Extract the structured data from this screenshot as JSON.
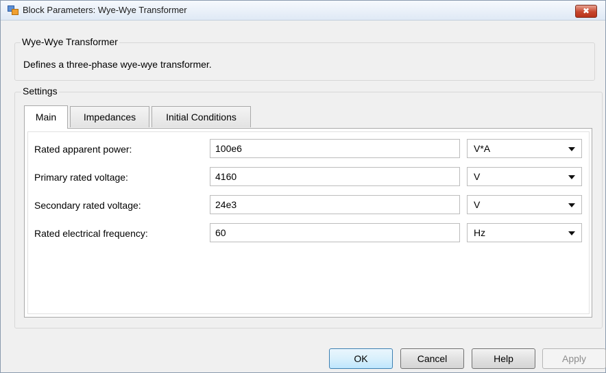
{
  "window": {
    "title": "Block Parameters: Wye-Wye Transformer",
    "close_label": "✖"
  },
  "block": {
    "group_title": "Wye-Wye Transformer",
    "description": "Defines a three-phase wye-wye transformer."
  },
  "settings": {
    "group_title": "Settings",
    "tabs": [
      {
        "label": "Main",
        "active": true
      },
      {
        "label": "Impedances",
        "active": false
      },
      {
        "label": "Initial Conditions",
        "active": false
      }
    ],
    "params": [
      {
        "label": "Rated apparent power:",
        "value": "100e6",
        "unit": "V*A"
      },
      {
        "label": "Primary rated voltage:",
        "value": "4160",
        "unit": "V"
      },
      {
        "label": "Secondary rated voltage:",
        "value": "24e3",
        "unit": "V"
      },
      {
        "label": "Rated electrical frequency:",
        "value": "60",
        "unit": "Hz"
      }
    ]
  },
  "buttons": {
    "ok": "OK",
    "cancel": "Cancel",
    "help": "Help",
    "apply": "Apply"
  },
  "colors": {
    "close_button": "#c7452c",
    "default_button_border": "#3c7fb1"
  }
}
